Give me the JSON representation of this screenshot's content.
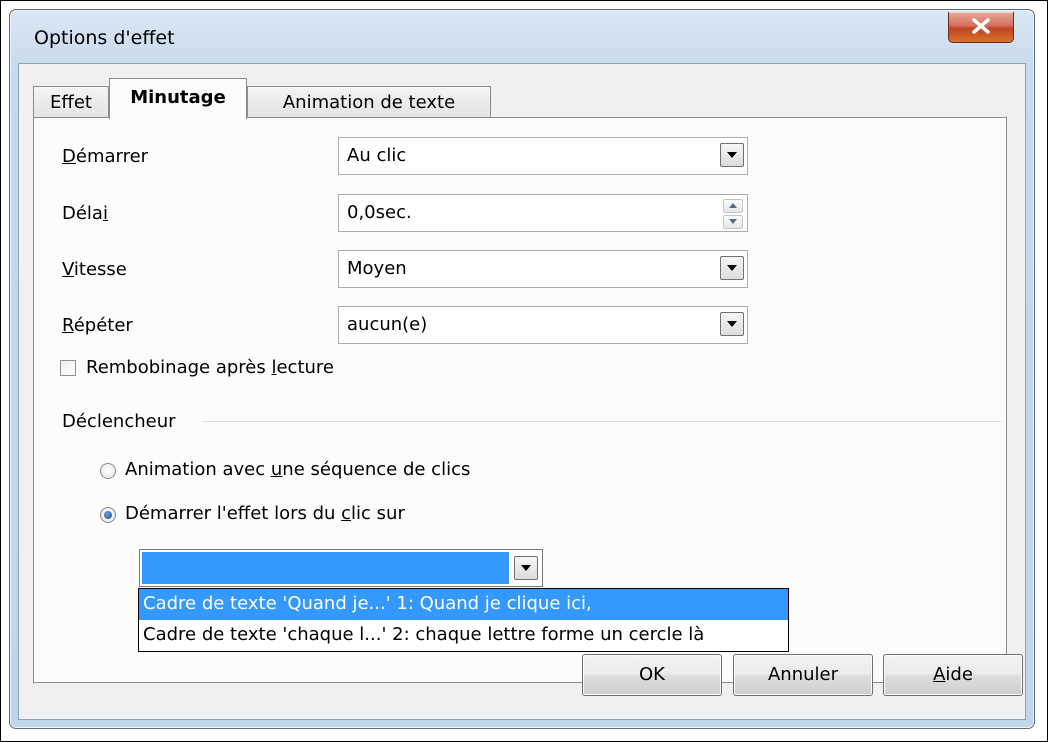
{
  "window": {
    "title": "Options d'effet",
    "close_glyph": "X"
  },
  "tabs": [
    {
      "label": "Effet",
      "active": false
    },
    {
      "label": "Minutage",
      "active": true
    },
    {
      "label": "Animation de texte",
      "active": false
    }
  ],
  "fields": {
    "start": {
      "label_pre": "",
      "label_accel": "D",
      "label_post": "émarrer",
      "value": "Au clic"
    },
    "delay": {
      "label_pre": "Déla",
      "label_accel": "i",
      "label_post": "",
      "value": "0,0sec."
    },
    "speed": {
      "label_pre": "",
      "label_accel": "V",
      "label_post": "itesse",
      "value": "Moyen"
    },
    "repeat": {
      "label_pre": "",
      "label_accel": "R",
      "label_post": "épéter",
      "value": "aucun(e)"
    }
  },
  "rewind": {
    "label_pre": "Rembobinage après ",
    "label_accel": "l",
    "label_post": "ecture",
    "checked": false
  },
  "trigger": {
    "group_label": "Déclencheur",
    "option_sequence": {
      "label_pre": "Animation avec ",
      "label_accel": "u",
      "label_post": "ne séquence de clics",
      "checked": false
    },
    "option_click": {
      "label_pre": "Démarrer l'effet lors du ",
      "label_accel": "c",
      "label_post": "lic sur",
      "checked": true
    },
    "combo_value": "",
    "list_items": [
      "Cadre de texte 'Quand je...' 1: Quand je clique ici,",
      "Cadre de texte 'chaque l...' 2: chaque lettre forme un cercle là"
    ],
    "selected_index": 0
  },
  "buttons": {
    "ok": "OK",
    "cancel": "Annuler",
    "help_accel": "A",
    "help_post": "ide"
  },
  "colors": {
    "selection": "#3399ff",
    "close_button": "#c24326",
    "window_frame": "#c7d9ec"
  }
}
